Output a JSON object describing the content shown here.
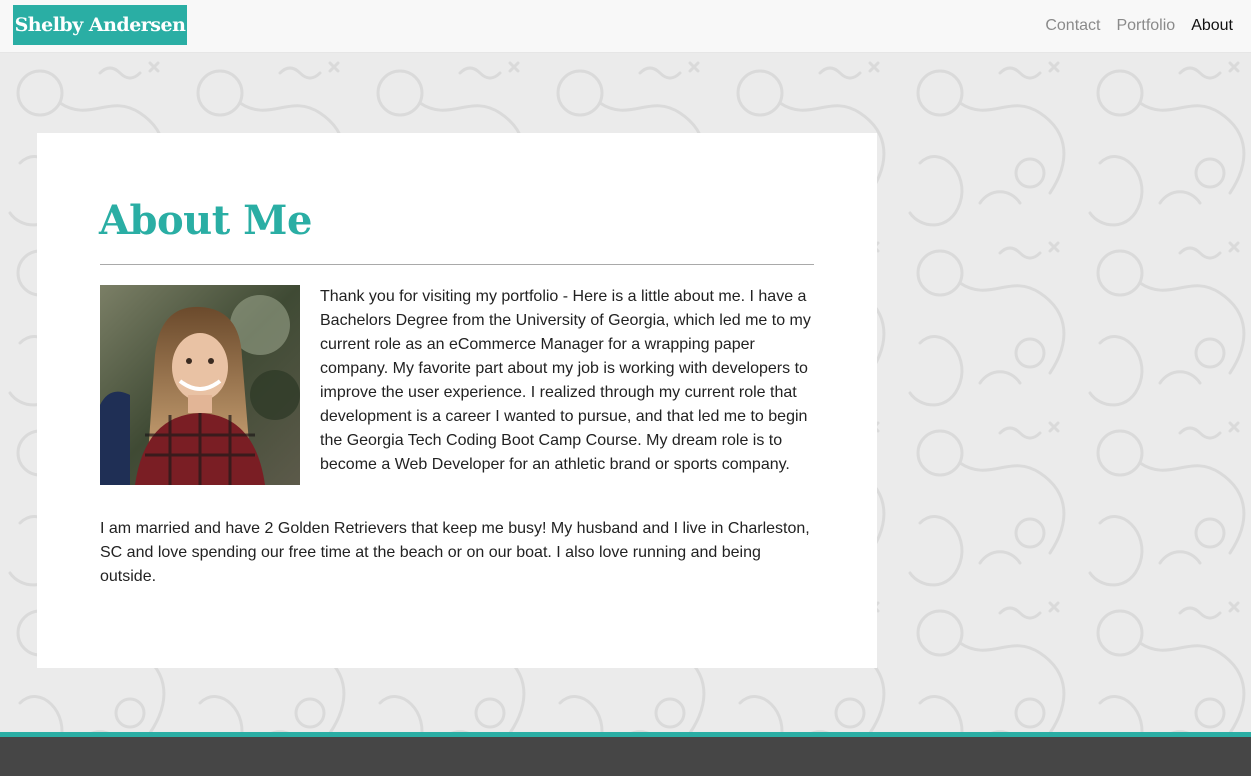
{
  "nav": {
    "brand": "Shelby Andersen",
    "links": [
      "Contact",
      "Portfolio",
      "About"
    ],
    "active": "About"
  },
  "about": {
    "title": "About Me",
    "paragraph1": "Thank you for visiting my portfolio - Here is a little about me. I have a Bachelors Degree from the University of Georgia, which led me to my current role as an eCommerce Manager for a wrapping paper company. My favorite part about my job is working with developers to improve the user experience. I realized through my current role that development is a career I wanted to pursue, and that led me to begin the Georgia Tech Coding Boot Camp Course. My dream role is to become a Web Developer for an athletic brand or sports company.",
    "paragraph2": "I am married and have 2 Golden Retrievers that keep me busy! My husband and I live in Charleston, SC and love spending our free time at the beach or on our boat. I also love running and being outside."
  },
  "colors": {
    "accent": "#2aaea4",
    "footer": "#464646",
    "background": "#ebebeb"
  }
}
